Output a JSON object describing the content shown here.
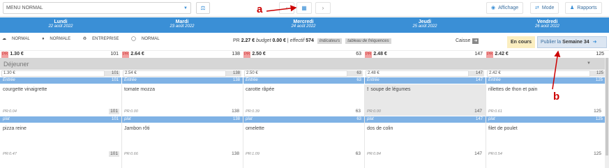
{
  "toolbar": {
    "menu_value": "MENU NORMAL",
    "affichage": "Affichage",
    "mode": "Mode",
    "rapports": "Rapports"
  },
  "days": [
    {
      "name": "Lundi",
      "date": "22 août 2022"
    },
    {
      "name": "Mardi",
      "date": "23 août 2022"
    },
    {
      "name": "Mercredi",
      "date": "24 août 2022"
    },
    {
      "name": "Jeudi",
      "date": "25 août 2022"
    },
    {
      "name": "Vendredi",
      "date": "26 août 2022"
    }
  ],
  "legend": [
    "NORMAL",
    "NORMALE",
    "ENTREPRISE",
    "NORMAL"
  ],
  "stats": {
    "pr_label": "PR",
    "pr_value": "2.27 €",
    "budget_label": "budget",
    "budget_value": "0.00 €",
    "effectif_label": "effectif",
    "effectif_value": "574",
    "indicateurs": "Indicateurs",
    "tableau": "tableau de fréquences"
  },
  "caisse": "Caisse",
  "status": "En cours",
  "publish": {
    "prefix": "Publier la",
    "week": "Semaine 34"
  },
  "day_pr": [
    {
      "tag": "PR",
      "value": "1.30 €",
      "count": "101"
    },
    {
      "tag": "PR",
      "value": "2.64 €",
      "count": "138"
    },
    {
      "tag": "PR",
      "value": "2.50 €",
      "count": "63"
    },
    {
      "tag": "PR",
      "value": "2.48 €",
      "count": "147"
    },
    {
      "tag": "PR",
      "value": "2.42 €",
      "count": "125"
    }
  ],
  "section": "Déjeuner",
  "section_prices": [
    {
      "value": "1.30 €",
      "count": "101"
    },
    {
      "value": "2.54 €",
      "count": "138"
    },
    {
      "value": "2.50 €",
      "count": "63"
    },
    {
      "value": "2.48 €",
      "count": "147"
    },
    {
      "value": "2.42 €",
      "count": "125"
    }
  ],
  "categories": [
    {
      "label": "Entrée",
      "counts": [
        "101",
        "138",
        "63",
        "147",
        "125"
      ],
      "dishes": [
        {
          "name": "courgette vinaigrette",
          "pr": "PR:0.04",
          "count": "101"
        },
        {
          "name": "tomate mozza",
          "pr": "PR:0.00",
          "count": "138"
        },
        {
          "name": "carotte râpée",
          "pr": "PR:0.39",
          "count": "63"
        },
        {
          "name": "soupe de légumes",
          "pr": "PR:0.00",
          "count": "147"
        },
        {
          "name": "rillettes de thon et pain",
          "pr": "PR:0.61",
          "count": "125"
        }
      ]
    },
    {
      "label": "plat",
      "counts": [
        "101",
        "138",
        "63",
        "147",
        "125"
      ],
      "dishes": [
        {
          "name": "pizza reine",
          "pr": "PR:0.47",
          "count": "101"
        },
        {
          "name": "Jambon rôti",
          "pr": "PR:0.66",
          "count": "138"
        },
        {
          "name": "omelette",
          "pr": "PR:1.09",
          "count": "63"
        },
        {
          "name": "dos de colin",
          "pr": "PR:0.84",
          "count": "147"
        },
        {
          "name": "filet de poulet",
          "pr": "PR:0.54",
          "count": "125"
        }
      ]
    }
  ],
  "annotations": {
    "a": "a",
    "b": "b"
  },
  "colors": {
    "primary": "#3a8fd6",
    "category": "#7fb2e5",
    "pr_tag": "#f2a0a0",
    "annotation": "#cc0000"
  }
}
